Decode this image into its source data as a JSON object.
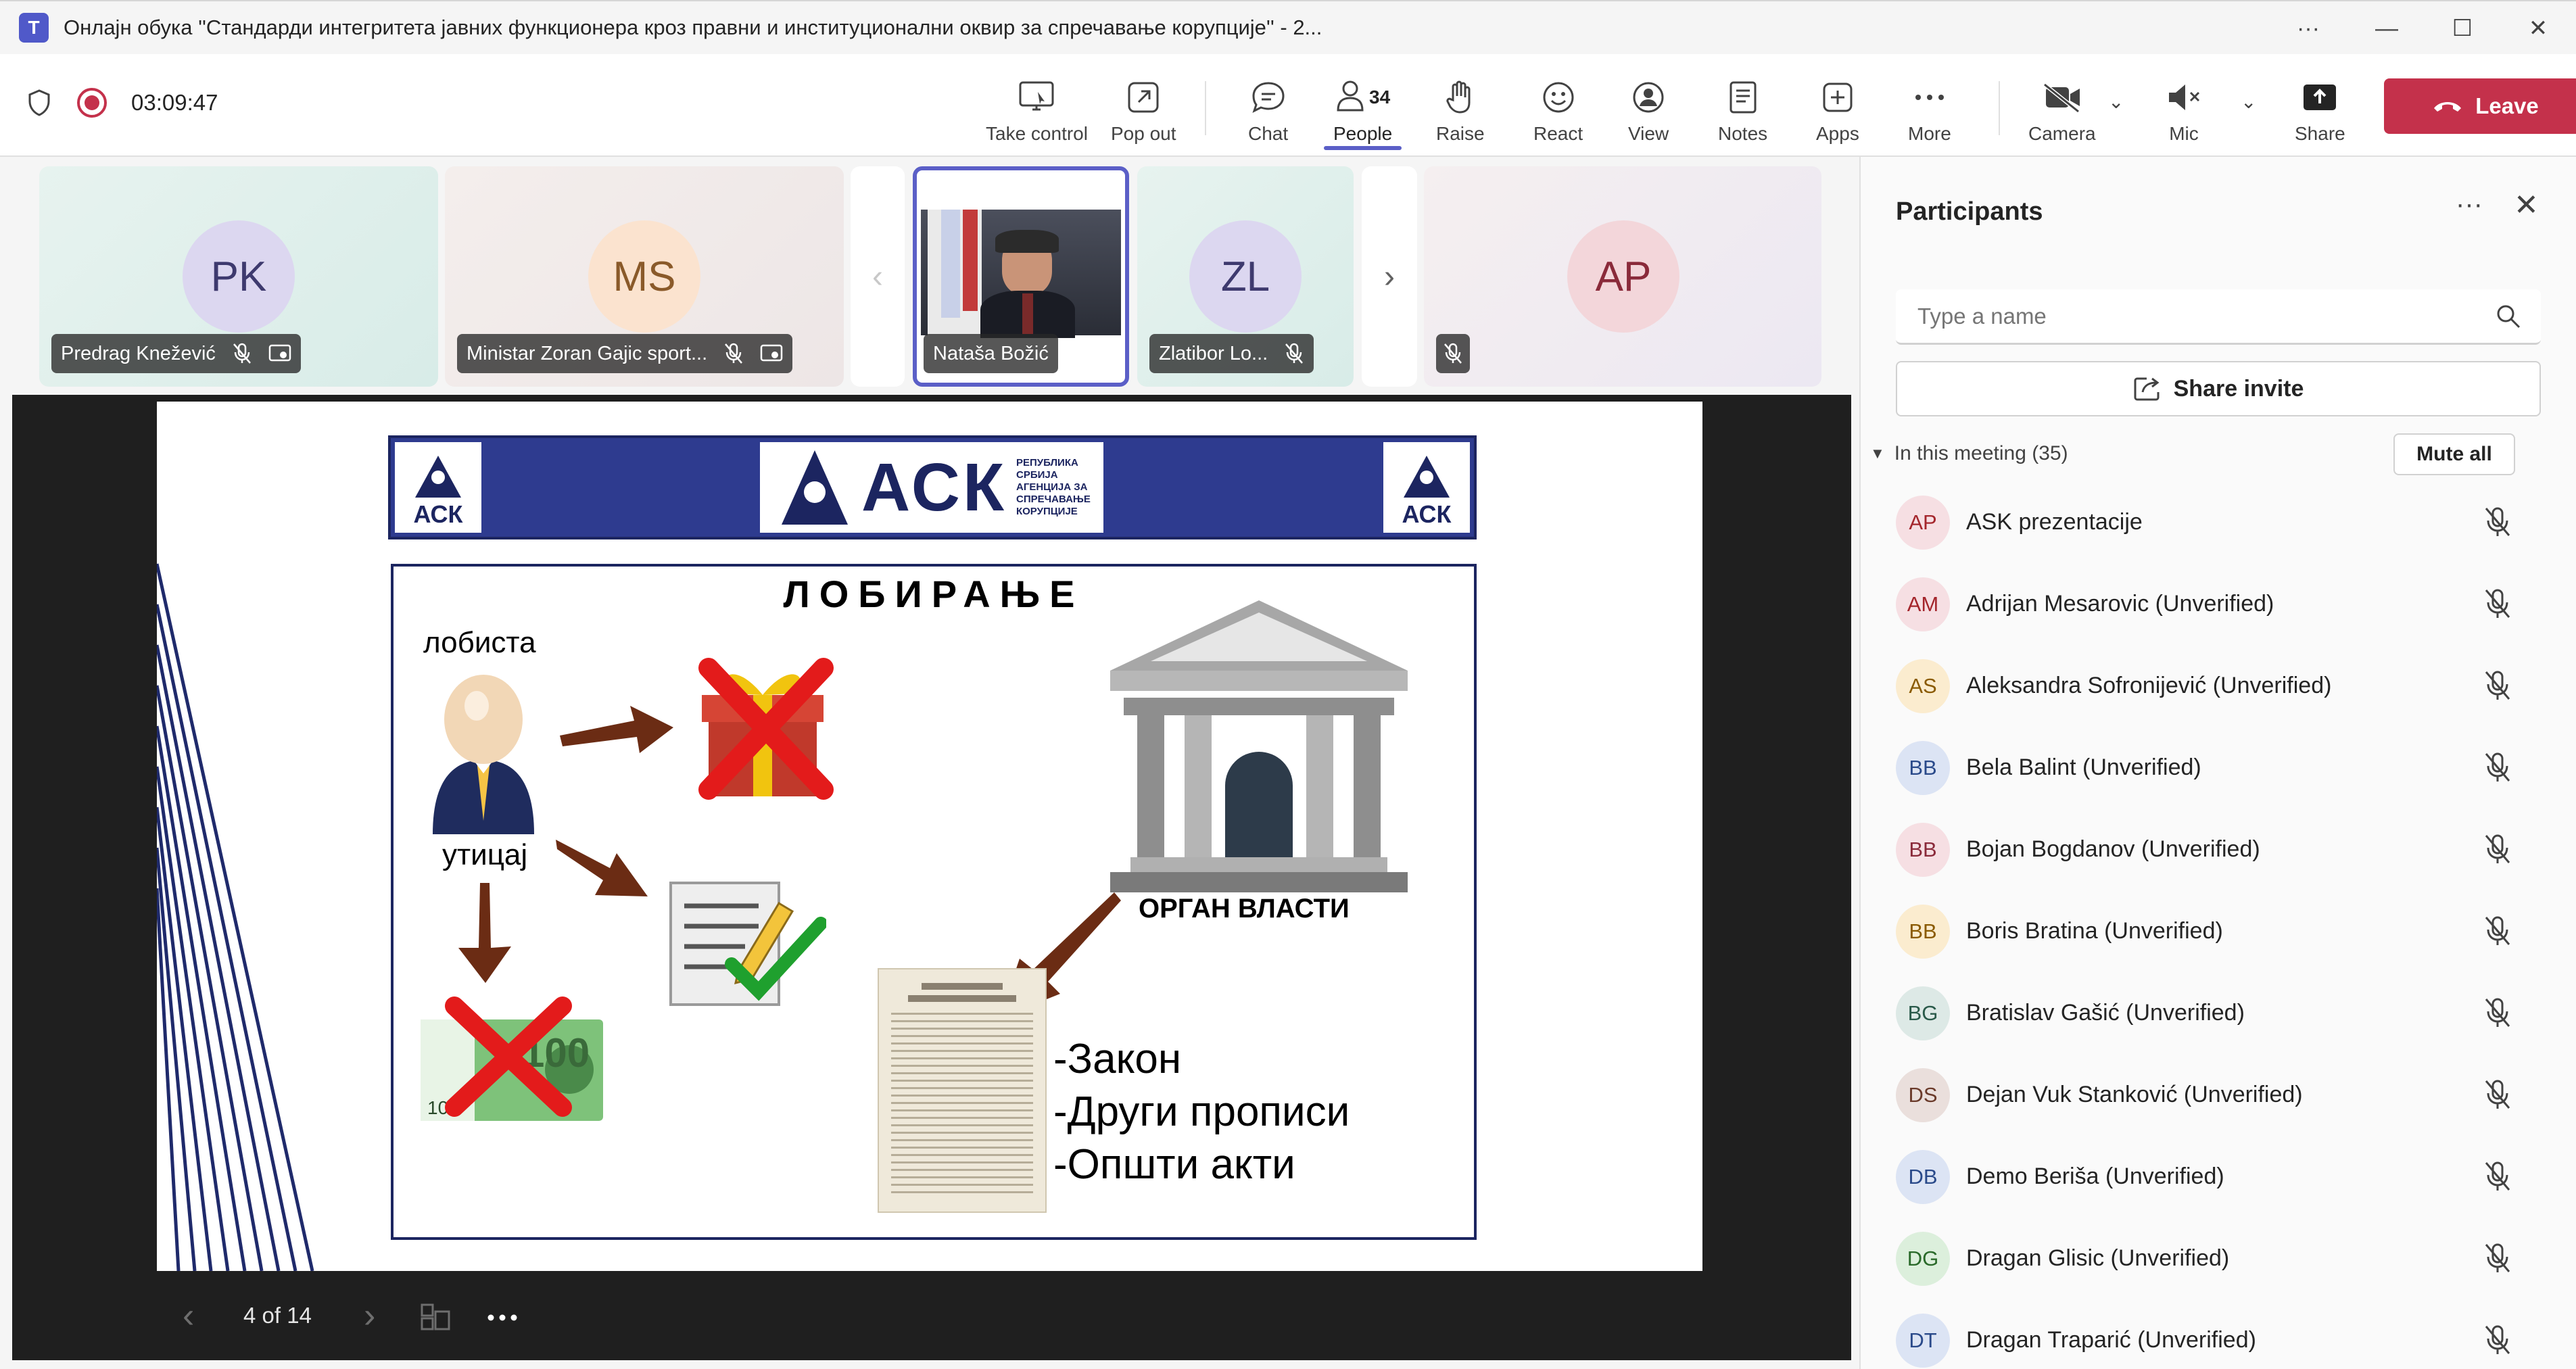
{
  "window": {
    "title": "Онлајн обука ''Стандарди интегритета јавних функционера кроз правни и институционални оквир за спречавање корупције'' - 2...",
    "app_icon": "teams-icon"
  },
  "toolbar": {
    "timer": "03:09:47",
    "take_control": "Take control",
    "pop_out": "Pop out",
    "chat": "Chat",
    "people": "People",
    "people_count": "34",
    "raise": "Raise",
    "react": "React",
    "view": "View",
    "notes": "Notes",
    "apps": "Apps",
    "more": "More",
    "camera": "Camera",
    "mic": "Mic",
    "share": "Share",
    "leave": "Leave"
  },
  "tiles": [
    {
      "initials": "PK",
      "name": "Predrag Knežević",
      "bg": "#e3f1ee",
      "avatar_bg": "#dcd7f0",
      "avatar_color": "#4a4a7a"
    },
    {
      "initials": "MS",
      "name": "Ministar Zoran Gajic sport...",
      "bg": "#f3ecea",
      "avatar_bg": "#fbe3cf",
      "avatar_color": "#8a5a2a"
    },
    {
      "name": "Nataša Božić"
    },
    {
      "initials": "ZL",
      "name": "Zlatibor Lo...",
      "bg": "#e3f1ee",
      "avatar_bg": "#dcd7f0",
      "avatar_color": "#4a4a7a"
    },
    {
      "initials": "AP",
      "name": "",
      "bg": "#f4eeee",
      "avatar_bg": "#f3d6da",
      "avatar_color": "#8a2a3a"
    }
  ],
  "slide": {
    "logo_text": "АСК",
    "logo_small_text": "РЕПУБЛИКА СРБИЈА АГЕНЦИЈА ЗА СПРЕЧАВАЊЕ КОРУПЦИЈЕ",
    "title": "ЛОБИРАЊЕ",
    "lobbyist": "лобиста",
    "influence": "утицај",
    "authority": "ОРГАН ВЛАСТИ",
    "items": [
      "-Закон",
      "-Други прописи",
      "-Општи акти"
    ],
    "page": "4 of 14"
  },
  "panel": {
    "title": "Participants",
    "search_placeholder": "Type a name",
    "share_invite": "Share invite",
    "in_meeting": "In this meeting (35)",
    "mute_all": "Mute all",
    "participants": [
      {
        "initials": "AP",
        "name": "ASK prezentacije",
        "bg": "#f6dfe3",
        "fg": "#a4262c"
      },
      {
        "initials": "AM",
        "name": "Adrijan Mesarovic (Unverified)",
        "bg": "#f6dfe3",
        "fg": "#a4262c"
      },
      {
        "initials": "AS",
        "name": "Aleksandra Sofronijević (Unverified)",
        "bg": "#fbeccf",
        "fg": "#8a5a00"
      },
      {
        "initials": "BB",
        "name": "Bela Balint (Unverified)",
        "bg": "#dce4f4",
        "fg": "#2a4a8a"
      },
      {
        "initials": "BB",
        "name": "Bojan Bogdanov (Unverified)",
        "bg": "#f6dfe3",
        "fg": "#8a2a3a"
      },
      {
        "initials": "BB",
        "name": "Boris Bratina (Unverified)",
        "bg": "#fbeccf",
        "fg": "#8a5a00"
      },
      {
        "initials": "BG",
        "name": "Bratislav Gašić (Unverified)",
        "bg": "#dde9e6",
        "fg": "#2a5a4a"
      },
      {
        "initials": "DS",
        "name": "Dejan Vuk Stanković (Unverified)",
        "bg": "#eadfdc",
        "fg": "#6a3a2a"
      },
      {
        "initials": "DB",
        "name": "Demo Beriša (Unverified)",
        "bg": "#dce4f4",
        "fg": "#2a4a8a"
      },
      {
        "initials": "DG",
        "name": "Dragan Glisic (Unverified)",
        "bg": "#dcefdc",
        "fg": "#2a6a2a"
      },
      {
        "initials": "DT",
        "name": "Dragan Traparić (Unverified)",
        "bg": "#dce4f4",
        "fg": "#2a4a8a"
      }
    ]
  }
}
